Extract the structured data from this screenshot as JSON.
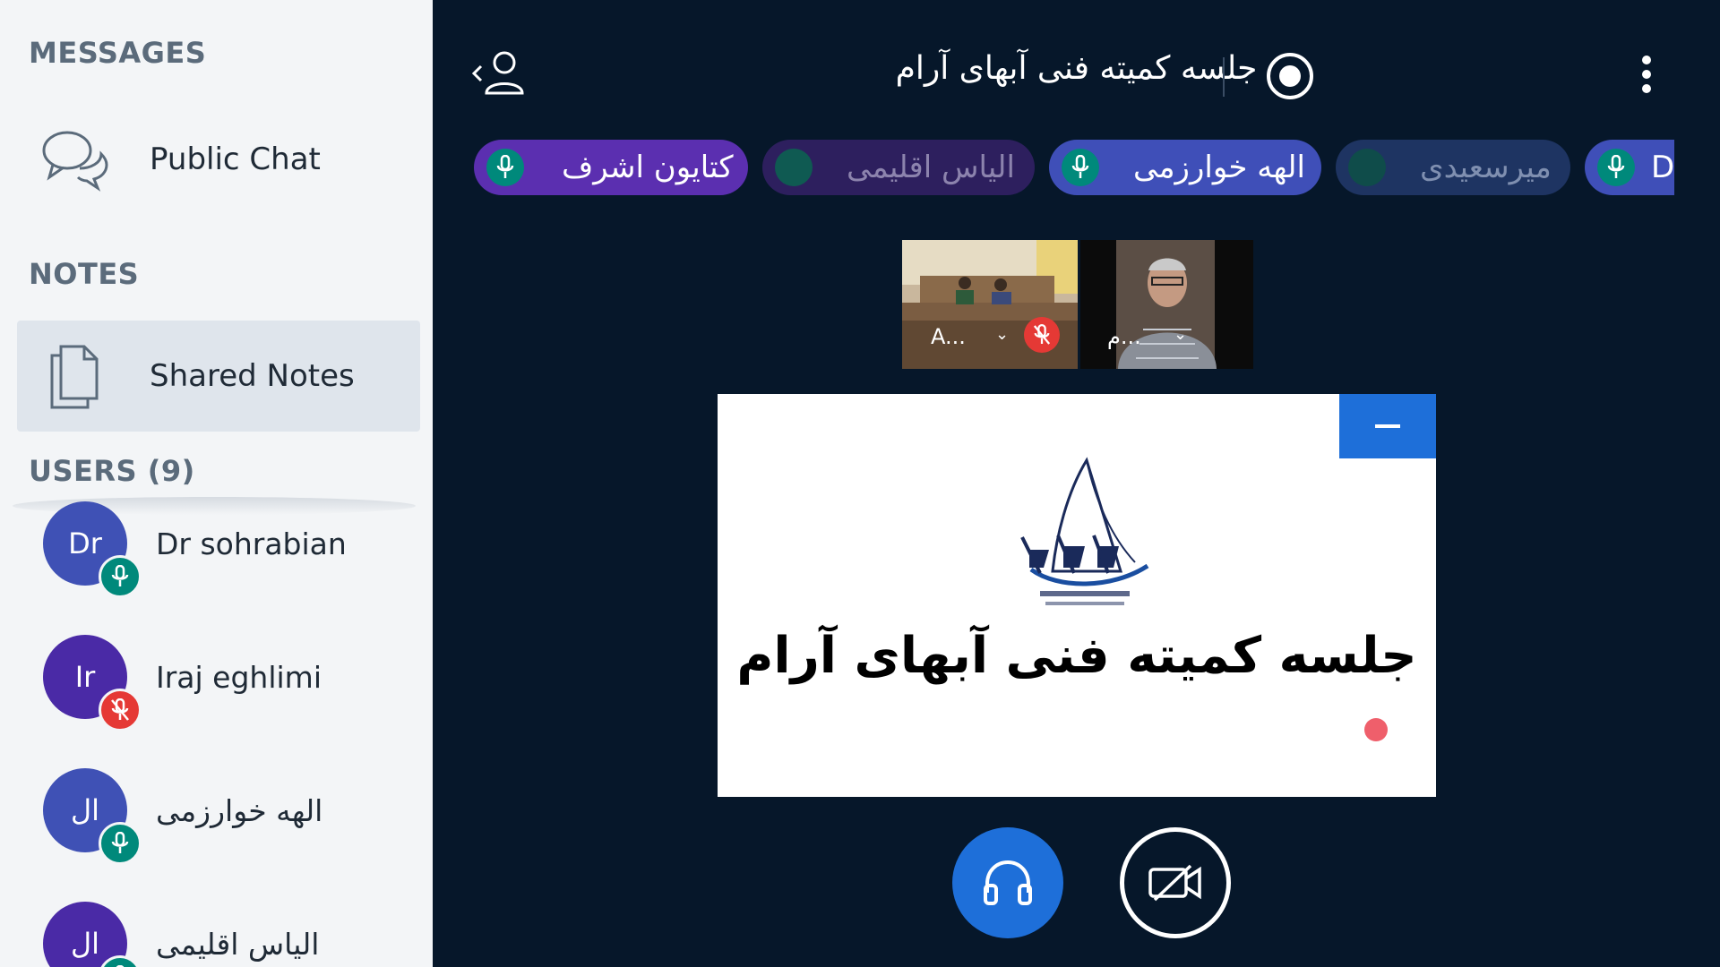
{
  "sidebar": {
    "messages_title": "MESSAGES",
    "public_chat_label": "Public Chat",
    "notes_title": "NOTES",
    "shared_notes_label": "Shared Notes",
    "users_title": "USERS (9)",
    "users": [
      {
        "initials": "Dr",
        "name": "Dr sohrabian",
        "color": "#3f51b5",
        "mic": "on"
      },
      {
        "initials": "Ir",
        "name": "Iraj eghlimi",
        "color": "#4a2aa6",
        "mic": "muted"
      },
      {
        "initials": "ال",
        "name": "الهه خوارزمی",
        "color": "#3f51b5",
        "mic": "on"
      },
      {
        "initials": "ال",
        "name": "الیاس اقلیمی",
        "color": "#4a2aa6",
        "mic": "on"
      }
    ]
  },
  "header": {
    "meeting_title": "جلسه کمیته فنی آبهای آرام"
  },
  "talkers": [
    {
      "name": "کتایون اشرف",
      "bg": "#5b2fb0",
      "active": true
    },
    {
      "name": "الیاس اقلیمی",
      "bg": "#2d1f5e",
      "active": false
    },
    {
      "name": "الهه خوارزمی",
      "bg": "#3f4fb8",
      "active": true
    },
    {
      "name": "میرسعیدی",
      "bg": "#1e3462",
      "active": false
    },
    {
      "name": "Dr",
      "bg": "#3f4fb8",
      "active": true
    }
  ],
  "videos": [
    {
      "name": "A...",
      "muted": true
    },
    {
      "name": "م...",
      "muted": false
    }
  ],
  "presentation": {
    "slide_title": "جلسه کمیته فنی آبهای آرام"
  },
  "colors": {
    "accent": "#1e6fd9",
    "mic_on": "#00897b",
    "mic_off": "#e53935",
    "background": "#06172a"
  }
}
